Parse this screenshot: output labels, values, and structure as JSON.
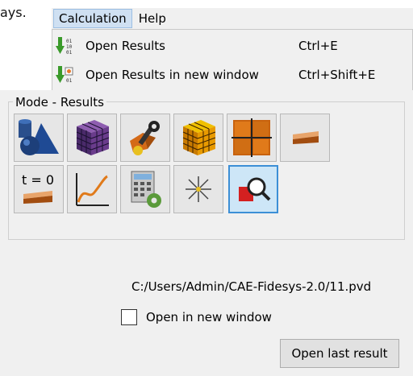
{
  "background_text": "ays.",
  "menubar": {
    "items": [
      "Calculation",
      "Help"
    ]
  },
  "dropdown": {
    "items": [
      {
        "label": "Open Results",
        "shortcut": "Ctrl+E"
      },
      {
        "label": "Open Results in new window",
        "shortcut": "Ctrl+Shift+E"
      }
    ]
  },
  "panel": {
    "group_title": "Mode - Results",
    "toolbar_row1": [
      "geometry-shapes-icon",
      "mesh-cube-icon",
      "material-settings-icon",
      "fine-mesh-cube-icon",
      "grid-blocks-icon",
      "beam-section-icon"
    ],
    "toolbar_row2": [
      "initial-state-t0-icon",
      "graph-curve-icon",
      "calculator-settings-icon",
      "sun-burst-icon",
      "results-magnifier-icon"
    ],
    "t0_label": "t = 0",
    "selected_tool": "results-magnifier-icon",
    "file_path": "C:/Users/Admin/CAE-Fidesys-2.0/11.pvd",
    "open_new_window_label": "Open in new window",
    "open_new_window_checked": false,
    "open_last_label": "Open last result"
  },
  "colors": {
    "selection": "#3c8fd6",
    "panel_bg": "#f0f0f0",
    "menu_highlight": "#cfe0f2"
  }
}
